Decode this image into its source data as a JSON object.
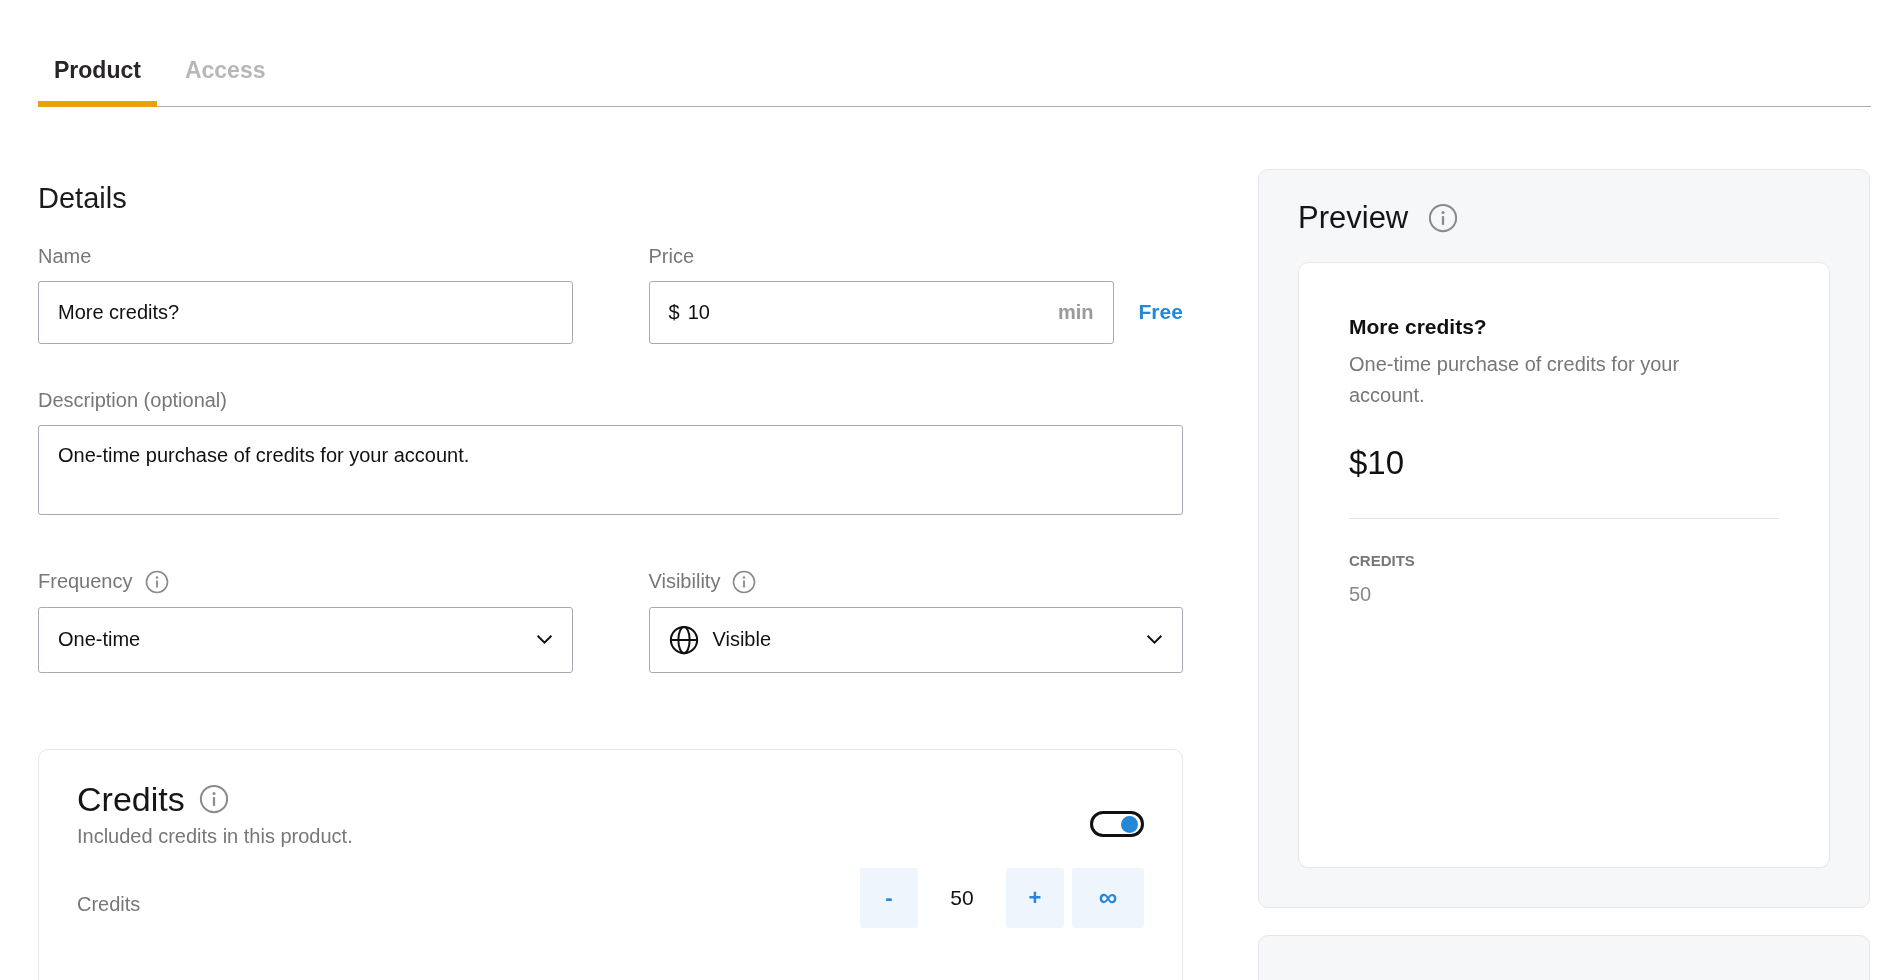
{
  "tabs": [
    {
      "label": "Product",
      "selected": true
    },
    {
      "label": "Access",
      "selected": false
    }
  ],
  "details": {
    "title": "Details",
    "name": {
      "label": "Name",
      "value": "More credits?"
    },
    "price": {
      "label": "Price",
      "currency": "$",
      "value": "10",
      "suffix": "min",
      "free_link": "Free"
    },
    "description": {
      "label": "Description (optional)",
      "value": "One-time purchase of credits for your account."
    },
    "frequency": {
      "label": "Frequency",
      "value": "One-time"
    },
    "visibility": {
      "label": "Visibility",
      "value": "Visible"
    }
  },
  "credits": {
    "title": "Credits",
    "subtitle": "Included credits in this product.",
    "enabled": true,
    "row": {
      "label": "Credits",
      "decrement": "-",
      "value": "50",
      "increment": "+",
      "unlimited": "∞"
    }
  },
  "preview": {
    "title": "Preview",
    "name": "More credits?",
    "description": "One-time purchase of credits for your account.",
    "price": "$10",
    "credits_label": "CREDITS",
    "credits_value": "50"
  }
}
